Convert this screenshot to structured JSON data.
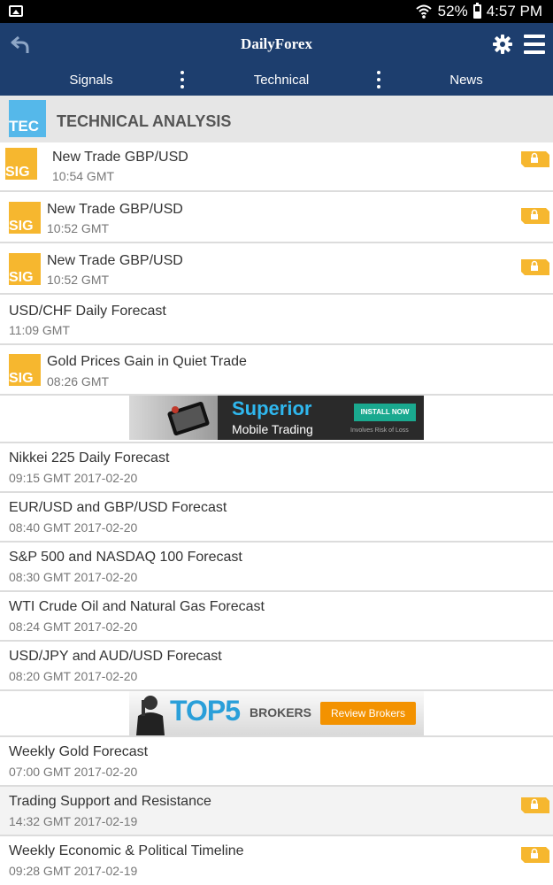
{
  "status": {
    "battery": "52%",
    "time": "4:57 PM"
  },
  "app": {
    "title": "DailyForex"
  },
  "tabs": [
    {
      "label": "Signals"
    },
    {
      "label": "Technical"
    },
    {
      "label": "News"
    }
  ],
  "section": {
    "badge": "TEC",
    "title": "TECHNICAL ANALYSIS"
  },
  "sig_badge": "SIG",
  "items": [
    {
      "title": "New Trade GBP/USD",
      "sub": "10:54 GMT"
    },
    {
      "title": "New Trade GBP/USD",
      "sub": "10:52 GMT"
    },
    {
      "title": "New Trade GBP/USD",
      "sub": "10:52 GMT"
    },
    {
      "title": "USD/CHF Daily Forecast",
      "sub": "11:09 GMT"
    },
    {
      "title": "Gold Prices Gain in Quiet Trade",
      "sub": "08:26 GMT"
    },
    {
      "title": "Nikkei 225 Daily Forecast",
      "sub": "09:15 GMT 2017-02-20"
    },
    {
      "title": "EUR/USD and GBP/USD Forecast",
      "sub": "08:40 GMT 2017-02-20"
    },
    {
      "title": "S&P 500 and NASDAQ 100 Forecast",
      "sub": "08:30 GMT 2017-02-20"
    },
    {
      "title": "WTI Crude Oil and Natural Gas Forecast",
      "sub": "08:24 GMT 2017-02-20"
    },
    {
      "title": "USD/JPY and AUD/USD Forecast",
      "sub": "08:20 GMT 2017-02-20"
    },
    {
      "title": "Weekly Gold Forecast",
      "sub": "07:00 GMT 2017-02-20"
    },
    {
      "title": "Trading Support and Resistance",
      "sub": "14:32 GMT 2017-02-19"
    },
    {
      "title": "Weekly Economic & Political Timeline",
      "sub": "09:28 GMT 2017-02-19"
    }
  ],
  "ad1": {
    "headline": "Superior",
    "subline": "Mobile Trading",
    "cta": "INSTALL NOW",
    "note": "Involves Risk of Loss"
  },
  "ad2": {
    "headline": "TOP5",
    "subline": "BROKERS",
    "cta": "Review Brokers"
  },
  "colors": {
    "nav": "#1d3e6e",
    "accent_blue": "#55b8ea",
    "signal_orange": "#f6b72f",
    "lock_orange": "#f6b72f"
  },
  "icons": {
    "back": "back-arrow-icon",
    "settings": "gear-icon",
    "menu": "hamburger-menu-icon",
    "premium": "lock-icon"
  }
}
